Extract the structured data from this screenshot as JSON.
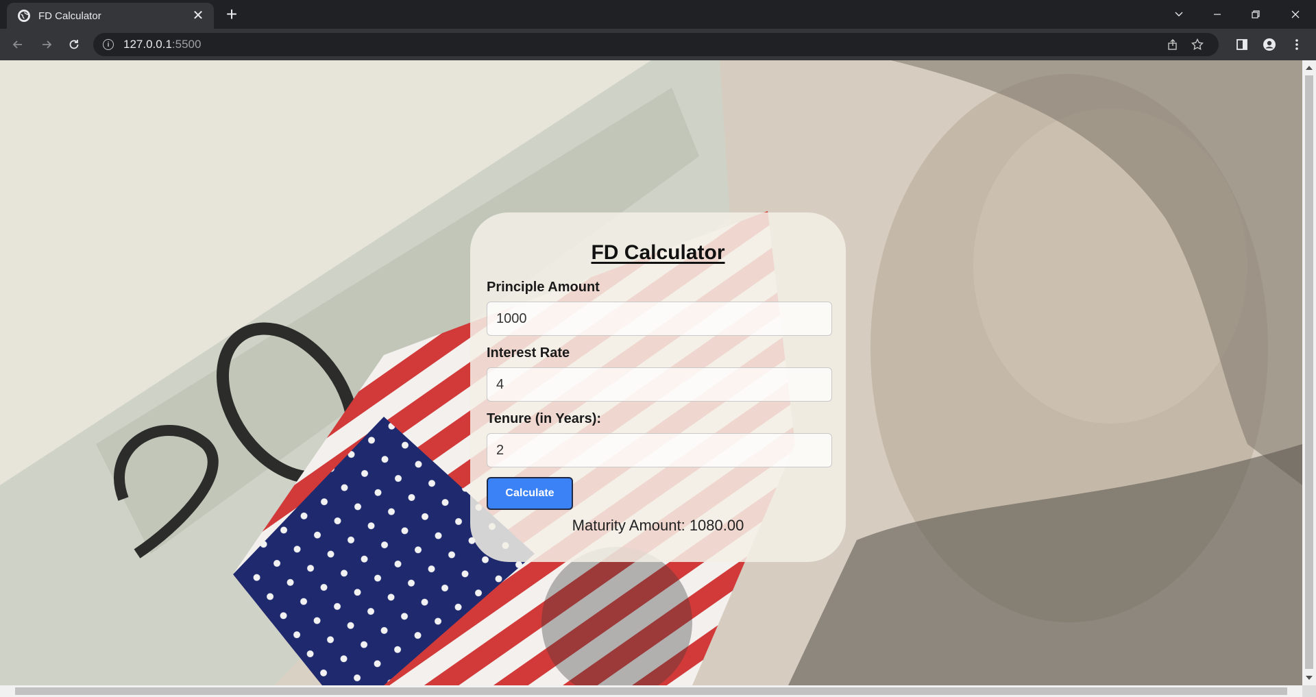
{
  "browser": {
    "tab_title": "FD Calculator",
    "url_host": "127.0.0.1",
    "url_port": ":5500",
    "icons": {
      "favicon": "globe-icon",
      "tab_close": "close-icon",
      "new_tab": "plus-icon",
      "back": "back-arrow-icon",
      "forward": "forward-arrow-icon",
      "reload": "reload-icon",
      "site_info": "info-icon",
      "share": "share-icon",
      "bookmark": "star-icon",
      "side_panel": "side-panel-icon",
      "profile": "profile-icon",
      "menu": "kebab-menu-icon",
      "tab_search": "chevron-down-icon",
      "minimize": "minimize-icon",
      "restore": "restore-icon",
      "close_window": "close-icon"
    }
  },
  "calculator": {
    "title": "FD Calculator",
    "fields": [
      {
        "label": "Principle Amount",
        "value": "1000"
      },
      {
        "label": "Interest Rate",
        "value": "4"
      },
      {
        "label": "Tenure (in Years):",
        "value": "2"
      }
    ],
    "button_label": "Calculate",
    "result_text": "Maturity Amount: 1080.00"
  },
  "colors": {
    "button": "#3b82f6",
    "card_background": "#f3f0e6",
    "chrome_dark": "#202124",
    "chrome_toolbar": "#35363a"
  }
}
